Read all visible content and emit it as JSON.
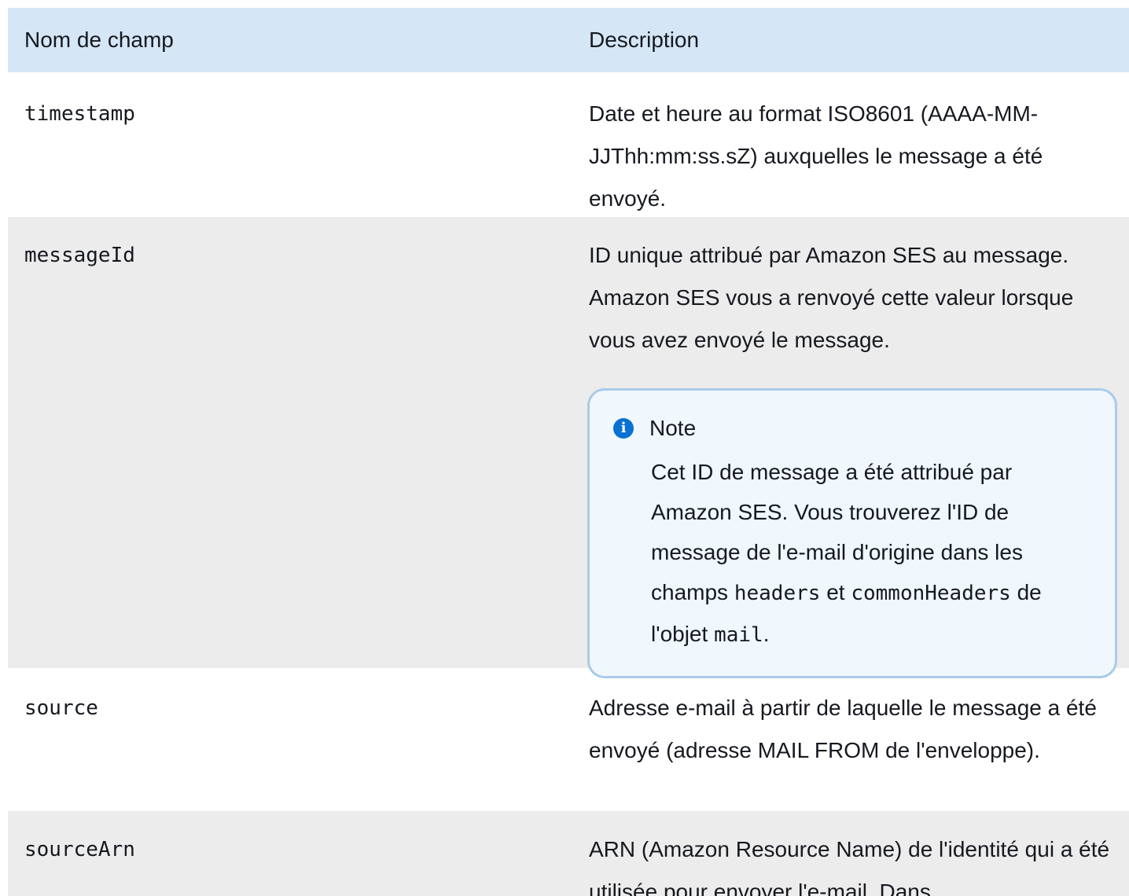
{
  "table": {
    "headers": {
      "name": "Nom de champ",
      "description": "Description"
    },
    "rows": [
      {
        "name": "timestamp",
        "description": "Date et heure au format ISO8601 (AAAA-MM-JJThh:mm:ss.sZ) auxquelles le message a été envoyé."
      },
      {
        "name": "messageId",
        "description": "ID unique attribué par Amazon SES au message. Amazon SES vous a renvoyé cette valeur lorsque vous avez envoyé le message.",
        "note": {
          "title": "Note",
          "icon": "info-icon",
          "text_1": "Cet ID de message a été attribué par Amazon SES. Vous trouverez l'ID de message de l'e-mail d'origine dans les champs",
          "code_1": "headers",
          "text_2": "et",
          "code_2": "commonHeaders",
          "text_3": "de l'objet",
          "code_3": "mail",
          "text_4": "."
        }
      },
      {
        "name": "source",
        "description": "Adresse e-mail à partir de laquelle le message a été envoyé (adresse MAIL FROM de l'enveloppe)."
      },
      {
        "name": "sourceArn",
        "description": "ARN (Amazon Resource Name) de l'identité qui a été utilisée pour envoyer l'e-mail. Dans"
      }
    ]
  }
}
